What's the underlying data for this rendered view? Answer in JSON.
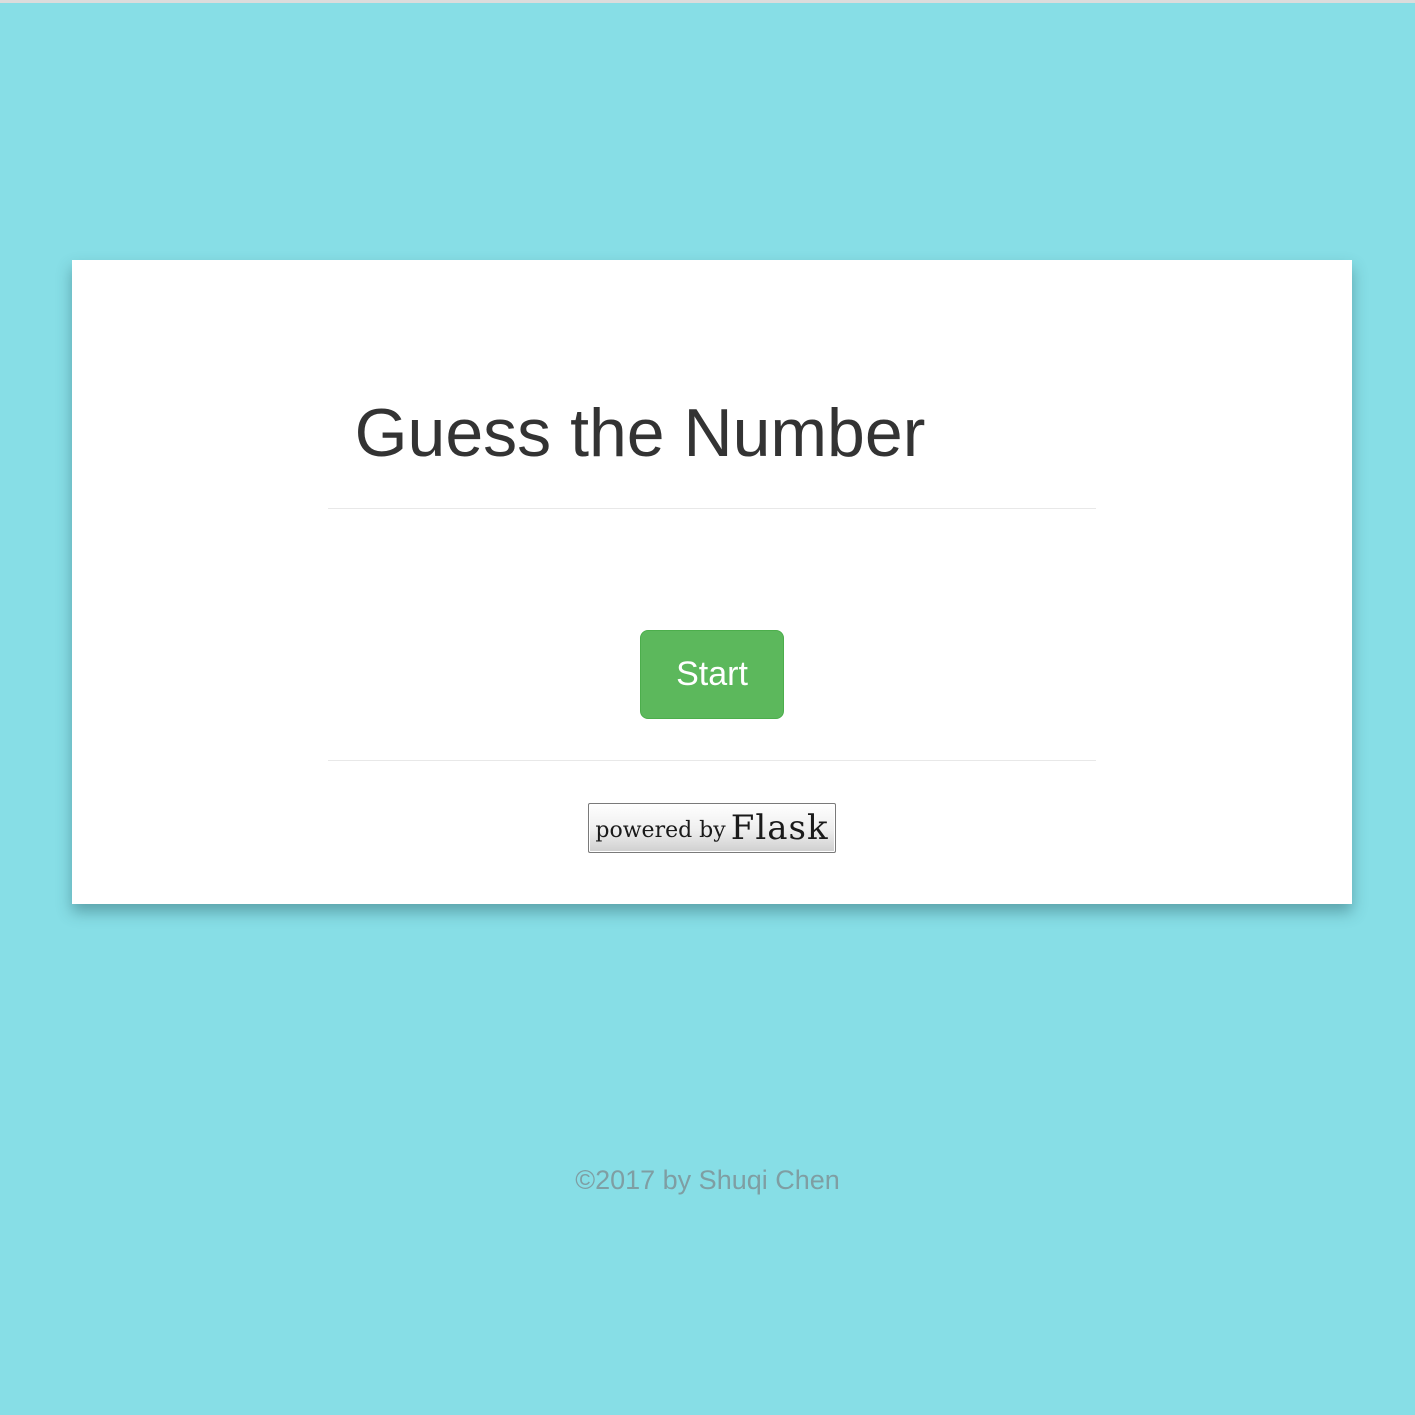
{
  "page": {
    "title": "Guess the Number"
  },
  "card": {
    "start_button_label": "Start",
    "badge": {
      "prefix": "powered by",
      "name": "Flask"
    }
  },
  "footer": {
    "text": "©2017 by Shuqi Chen"
  },
  "colors": {
    "background": "#87dee6",
    "card": "#ffffff",
    "button": "#5cb85c",
    "title_text": "#333333",
    "footer_text": "#7f9ea3"
  }
}
